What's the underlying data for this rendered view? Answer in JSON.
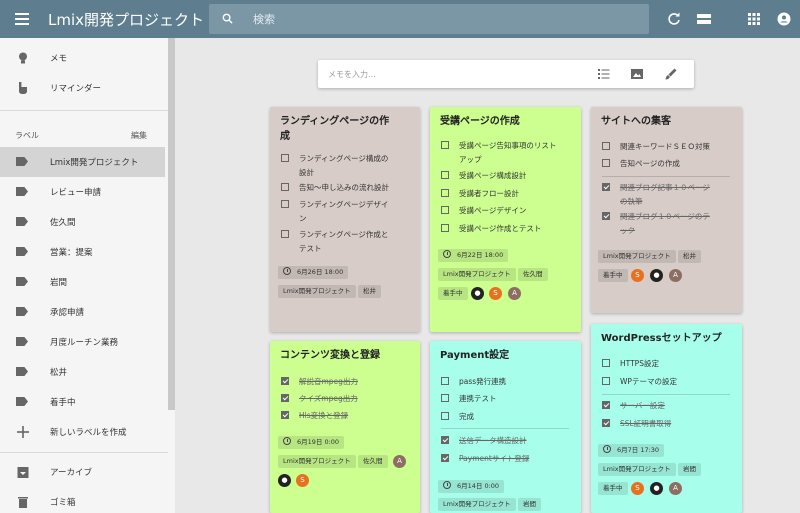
{
  "app": {
    "title": "Lmix開発プロジェクト"
  },
  "search": {
    "placeholder": "検索"
  },
  "sidebar": {
    "notes_label": "メモ",
    "reminders_label": "リマインダー",
    "labels_heading": "ラベル",
    "edit_label": "編集",
    "labels": [
      "Lmix開発プロジェクト",
      "レビュー申請",
      "佐久間",
      "営業：提案",
      "岩間",
      "承認申請",
      "月度ルーチン業務",
      "松井",
      "着手中"
    ],
    "new_label": "新しいラベルを作成",
    "archive_label": "アーカイブ",
    "trash_label": "ゴミ箱"
  },
  "memo": {
    "placeholder": "メモを入力..."
  },
  "cards": [
    {
      "title_line1": "ランディングページの作",
      "title_line2": "成",
      "items": [
        {
          "l1": "ランディングページ構成の",
          "l2": "設計",
          "done": false
        },
        {
          "l1": "告知〜申し込みの流れ設計",
          "done": false
        },
        {
          "l1": "ランディングページデザイ",
          "l2": "ン",
          "done": false
        },
        {
          "l1": "ランディングページ作成と",
          "l2": "テスト",
          "done": false
        }
      ],
      "date": "6月26日 18:00",
      "labels": [
        "Lmix開発プロジェクト",
        "松井"
      ]
    },
    {
      "title_line1": "受講ページの作成",
      "items": [
        {
          "l1": "受講ページ告知事項のリスト",
          "l2": "アップ",
          "done": false
        },
        {
          "l1": "受講ページ構成設計",
          "done": false
        },
        {
          "l1": "受講者フロー設計",
          "done": false
        },
        {
          "l1": "受講ページデザイン",
          "done": false
        },
        {
          "l1": "受講ページ作成とテスト",
          "done": false
        }
      ],
      "date": "6月22日 18:00",
      "labels": [
        "Lmix開発プロジェクト",
        "佐久間",
        "着手中"
      ],
      "avatars": [
        "S",
        "A"
      ]
    },
    {
      "title_line1": "サイトへの集客",
      "items": [
        {
          "l1": "関連キーワードＳＥＯ対策",
          "done": false
        },
        {
          "l1": "告知ページの作成",
          "done": false
        },
        {
          "l1": "関連ブログ記事１０ページ",
          "l2": "の執筆",
          "done": true
        },
        {
          "l1": "関連ブログ１０ページのテ",
          "l2": "ック",
          "done": true
        }
      ],
      "labels": [
        "Lmix開発プロジェクト",
        "松井",
        "着手中"
      ],
      "avatars": [
        "S",
        "A"
      ]
    },
    {
      "title_line1": "コンテンツ変換と登録",
      "items": [
        {
          "l1": "解説音mpeg出力",
          "done": true
        },
        {
          "l1": "クイズmpeg出力",
          "done": true
        },
        {
          "l1": "Hls変換と登録",
          "done": true
        }
      ],
      "date": "6月19日 0:00",
      "labels": [
        "Lmix開発プロジェクト",
        "佐久間"
      ],
      "avatars": [
        "A",
        "S"
      ]
    },
    {
      "title_line1": "Payment設定",
      "items": [
        {
          "l1": "pass発行連携",
          "done": false
        },
        {
          "l1": "連携テスト",
          "done": false
        },
        {
          "l1": "完成",
          "done": false
        },
        {
          "l1": "送信データ構造設計",
          "done": true
        },
        {
          "l1": "Paymentサイト登録",
          "done": true
        }
      ],
      "date": "6月14日 0:00",
      "labels": [
        "Lmix開発プロジェクト",
        "岩間"
      ]
    },
    {
      "title_line1": "WordPressセットアップ",
      "items": [
        {
          "l1": "HTTPS設定",
          "done": false
        },
        {
          "l1": "WPテーマの設定",
          "done": false
        },
        {
          "l1": "サーバー設定",
          "done": true
        },
        {
          "l1": "SSL証明書取得",
          "done": true
        }
      ],
      "date": "6月7日 17:30",
      "labels": [
        "Lmix開発プロジェクト",
        "岩間",
        "着手中"
      ],
      "avatars": [
        "S",
        "A"
      ]
    }
  ],
  "colors": {
    "header": "#5e7d8f",
    "card_brown": "#d7ccc8",
    "card_green": "#ccff90",
    "card_teal": "#a7ffeb",
    "avatar_orange": "#e8711f",
    "avatar_brown": "#8d6e63"
  },
  "icons": [
    "menu-icon",
    "search-icon",
    "refresh-icon",
    "list-view-icon",
    "apps-icon",
    "account-icon",
    "bulb-icon",
    "reminder-icon",
    "label-icon",
    "plus-icon",
    "archive-icon",
    "trash-icon",
    "checklist-icon",
    "image-icon",
    "brush-icon",
    "clock-icon"
  ]
}
